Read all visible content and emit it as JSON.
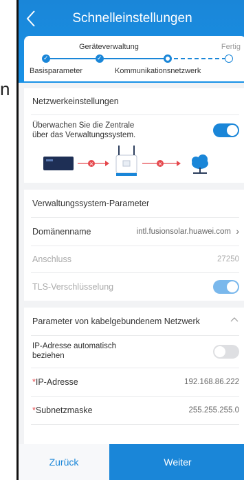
{
  "side_char": "n",
  "header": {
    "title": "Schnelleinstellungen"
  },
  "steps": {
    "top_label": "Geräteverwaltung",
    "end_label": "Fertig",
    "left_label": "Basisparameter",
    "right_label": "Kommunikationsnetzwerk"
  },
  "network": {
    "section_title": "Netzwerkeinstellungen",
    "monitor_label_line1": "Überwachen Sie die Zentrale",
    "monitor_label_line2": "über das Verwaltungssystem."
  },
  "mgmt": {
    "section_title": "Verwaltungssystem-Parameter",
    "domain_label": "Domänenname",
    "domain_value": "intl.fusionsolar.huawei.com",
    "port_label": "Anschluss",
    "port_value": "27250",
    "tls_label": "TLS-Verschlüsselung"
  },
  "wired": {
    "section_title": "Parameter von kabelgebundenem Netzwerk",
    "dhcp_label_line1": "IP-Adresse automatisch",
    "dhcp_label_line2": "beziehen",
    "ip_label": "IP-Adresse",
    "ip_value": "192.168.86.222",
    "mask_label": "Subnetzmaske",
    "mask_value": "255.255.255.0",
    "required_mark": "*"
  },
  "footer": {
    "back_label": "Zurück",
    "next_label": "Weiter"
  },
  "colors": {
    "accent": "#1a86d8",
    "error": "#e5484d"
  }
}
